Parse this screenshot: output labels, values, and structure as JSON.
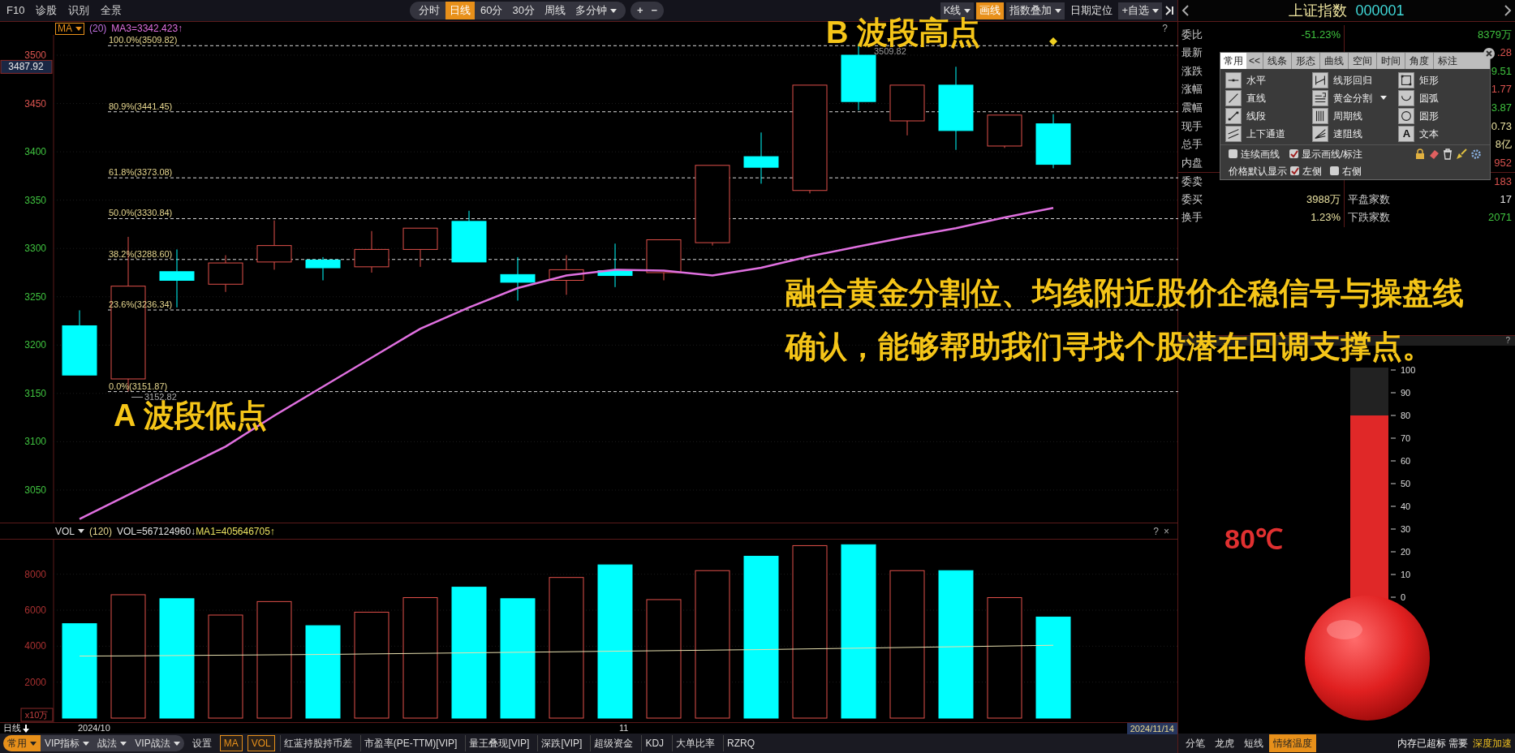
{
  "top_bar": {
    "left_items": [
      "F10",
      "诊股",
      "识别",
      "全景"
    ],
    "periods": [
      {
        "label": "分时",
        "selected": false,
        "dropdown": false
      },
      {
        "label": "日线",
        "selected": true,
        "dropdown": false
      },
      {
        "label": "60分",
        "selected": false,
        "dropdown": false
      },
      {
        "label": "30分",
        "selected": false,
        "dropdown": false
      },
      {
        "label": "周线",
        "selected": false,
        "dropdown": false
      },
      {
        "label": "多分钟",
        "selected": false,
        "dropdown": true
      }
    ],
    "zoom_buttons": [
      "+",
      "−"
    ],
    "right_items": [
      {
        "label": "K线",
        "selected": false,
        "dropdown": true
      },
      {
        "label": "画线",
        "selected": true,
        "dropdown": false
      },
      {
        "label": "指数叠加",
        "selected": false,
        "dropdown": true
      },
      {
        "label": "日期定位",
        "selected": false,
        "dropdown": false
      },
      {
        "label": "+自选",
        "selected": false,
        "dropdown": true
      }
    ]
  },
  "price_chart": {
    "indicator": "MA",
    "param": "(20)",
    "ma_value": "MA3=3342.423↑",
    "help": "?",
    "axis": [
      {
        "label": "3500",
        "color": "#d9534f"
      },
      {
        "label": "3450",
        "color": "#d9534f"
      },
      {
        "label": "3400",
        "color": "#3fc23f"
      },
      {
        "label": "3350",
        "color": "#3fc23f"
      },
      {
        "label": "3300",
        "color": "#3fc23f"
      },
      {
        "label": "3250",
        "color": "#3fc23f"
      },
      {
        "label": "3200",
        "color": "#3fc23f"
      },
      {
        "label": "3150",
        "color": "#3fc23f"
      },
      {
        "label": "3100",
        "color": "#3fc23f"
      },
      {
        "label": "3050",
        "color": "#3fc23f"
      }
    ],
    "current_price": "3487.92",
    "fib_levels": [
      "100.0%(3509.82)",
      "80.9%(3441.45)",
      "61.8%(3373.08)",
      "50.0%(3330.84)",
      "38.2%(3288.60)",
      "23.6%(3236.34)",
      "0.0%(3151.87)"
    ],
    "high_label": "3509.82",
    "low_label": "3152.82",
    "high_note": "B 波段高点",
    "low_note": "A 波段低点",
    "caption": [
      "融合黄金分割位、均线附近股价企稳信号与操盘线",
      "确认，能够帮助我们寻找个股潜在回调支撑点。"
    ]
  },
  "volume_panel": {
    "indicator": "VOL",
    "param": "(120)",
    "vol_value": "VOL=567124960↓",
    "ma_value": "MA1=405646705↑",
    "help": "?",
    "close": "×",
    "unit": "x10万",
    "axis": [
      "8000",
      "6000",
      "4000",
      "2000"
    ]
  },
  "date_axis": {
    "period": "日线",
    "labels": [
      "2024/10",
      "11"
    ],
    "current_date": "2024/11/14"
  },
  "bottom_toolbar": {
    "menus": [
      {
        "label": "常用",
        "selected": true
      },
      {
        "label": "VIP指标",
        "selected": false
      },
      {
        "label": "战法",
        "selected": false
      },
      {
        "label": "VIP战法",
        "selected": false
      }
    ],
    "settings": "设置",
    "indicators": [
      {
        "label": "MA",
        "selected": true
      },
      {
        "label": "VOL",
        "selected": true
      },
      {
        "label": "红蓝持股持币差",
        "selected": false
      },
      {
        "label": "市盈率(PE-TTM)[VIP]",
        "selected": false
      },
      {
        "label": "量王叠现[VIP]",
        "selected": false
      },
      {
        "label": "深跌[VIP]",
        "selected": false
      },
      {
        "label": "超级资金",
        "selected": false
      },
      {
        "label": "KDJ",
        "selected": false
      },
      {
        "label": "大单比率",
        "selected": false
      },
      {
        "label": "RZRQ",
        "selected": false
      }
    ]
  },
  "quote_panel": {
    "title": "上证指数",
    "code": "000001",
    "rows": [
      {
        "label": "委比",
        "value": {
          "text": "-51.23%",
          "color": "#3fc23f"
        },
        "value2": {
          "text": "8379万",
          "color": "#3fc23f"
        }
      },
      {
        "label": "最新",
        "value2": {
          "text": ".28",
          "color": "#d9534f"
        }
      },
      {
        "label": "涨跌",
        "value2": {
          "text": "9.51",
          "color": "#3fc23f"
        }
      },
      {
        "label": "涨幅",
        "value2": {
          "text": "1.77",
          "color": "#d9534f"
        }
      },
      {
        "label": "震幅",
        "value2": {
          "text": "3.87",
          "color": "#3fc23f"
        }
      },
      {
        "label": "现手",
        "value2": {
          "text": "0.73",
          "color": "#e8e0a0"
        }
      },
      {
        "label": "总手",
        "value2": {
          "text": "8亿",
          "color": "#e8e0a0"
        }
      },
      {
        "label": "内盘",
        "value2": {
          "text": "952",
          "color": "#d9534f"
        }
      },
      {
        "label": "委卖",
        "value2": {
          "text": "183",
          "color": "#d9534f"
        }
      },
      {
        "label": "委买",
        "value": {
          "text": "3988万",
          "color": "#e8e0a0"
        },
        "label2": "平盘家数",
        "value2": {
          "text": "17",
          "color": "#e0e0e0"
        }
      },
      {
        "label": "换手",
        "value": {
          "text": "1.23%",
          "color": "#e8e0a0"
        },
        "label2": "下跌家数",
        "value2": {
          "text": "2071",
          "color": "#3fc23f"
        }
      }
    ]
  },
  "temperature_panel": {
    "help": "?",
    "reading": "80℃",
    "level": 0.8,
    "scale": [
      "100",
      "90",
      "80",
      "70",
      "60",
      "50",
      "40",
      "30",
      "20",
      "10",
      "0"
    ]
  },
  "bottom_tabs": [
    {
      "label": "分笔",
      "selected": false
    },
    {
      "label": "龙虎",
      "selected": false
    },
    {
      "label": "短线",
      "selected": false
    },
    {
      "label": "情绪温度",
      "selected": true
    }
  ],
  "notice": {
    "text": "内存已超标 需要",
    "link": "深度加速"
  },
  "drawing_tools": {
    "tabs": [
      {
        "label": "常用",
        "selected": true
      },
      {
        "label": "线条",
        "selected": false
      },
      {
        "label": "形态",
        "selected": false
      },
      {
        "label": "曲线",
        "selected": false
      },
      {
        "label": "空间",
        "selected": false
      },
      {
        "label": "时间",
        "selected": false
      },
      {
        "label": "角度",
        "selected": false
      },
      {
        "label": "标注",
        "selected": false
      }
    ],
    "scroll_left": "<<",
    "tools": [
      {
        "label": "水平",
        "dropdown": false
      },
      {
        "label": "线形回归",
        "dropdown": false
      },
      {
        "label": "矩形",
        "dropdown": false
      },
      {
        "label": "直线",
        "dropdown": false
      },
      {
        "label": "黄金分割",
        "dropdown": true
      },
      {
        "label": "圆弧",
        "dropdown": false
      },
      {
        "label": "线段",
        "dropdown": false
      },
      {
        "label": "周期线",
        "dropdown": false
      },
      {
        "label": "圆形",
        "dropdown": false
      },
      {
        "label": "上下通道",
        "dropdown": false
      },
      {
        "label": "速阻线",
        "dropdown": false
      },
      {
        "label": "文本",
        "dropdown": false,
        "icon_text": "A"
      }
    ],
    "options": [
      {
        "label": "连续画线",
        "checked": false
      },
      {
        "label": "显示画线/标注",
        "checked": true
      }
    ],
    "price_display": {
      "label": "价格默认显示",
      "options": [
        {
          "label": "左侧",
          "checked": true
        },
        {
          "label": "右侧",
          "checked": false
        }
      ]
    }
  }
}
